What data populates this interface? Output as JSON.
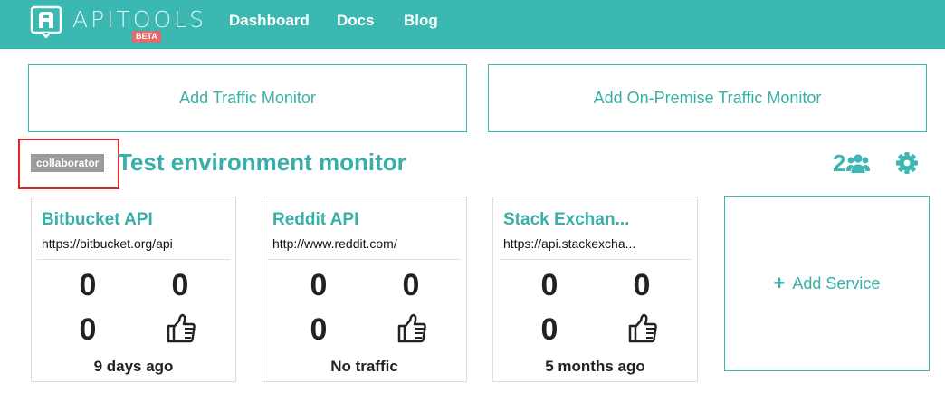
{
  "nav": {
    "logo_text": "APITOOLS",
    "beta_badge": "BETA",
    "links": [
      "Dashboard",
      "Docs",
      "Blog"
    ]
  },
  "cta": {
    "add_traffic_monitor": "Add Traffic Monitor",
    "add_onpremise_monitor": "Add On-Premise Traffic Monitor"
  },
  "monitor": {
    "role_badge": "collaborator",
    "title": "Test environment monitor",
    "member_count": "2"
  },
  "services": [
    {
      "name": "Bitbucket API",
      "url": "https://bitbucket.org/api",
      "stat_a": "0",
      "stat_b": "0",
      "stat_c": "0",
      "status": "9 days ago"
    },
    {
      "name": "Reddit API",
      "url": "http://www.reddit.com/",
      "stat_a": "0",
      "stat_b": "0",
      "stat_c": "0",
      "status": "No traffic"
    },
    {
      "name": "Stack Exchan...",
      "url": "https://api.stackexcha...",
      "stat_a": "0",
      "stat_b": "0",
      "stat_c": "0",
      "status": "5 months ago"
    }
  ],
  "add_service": {
    "icon": "+",
    "label": "Add Service"
  },
  "colors": {
    "brand": "#3bb8b2",
    "beta": "#e26a6a",
    "highlight": "#e0262b",
    "badge": "#9a9a9a"
  },
  "icons": [
    "logo-icon",
    "users-icon",
    "gear-icon",
    "thumbs-up-icon",
    "plus-icon"
  ]
}
